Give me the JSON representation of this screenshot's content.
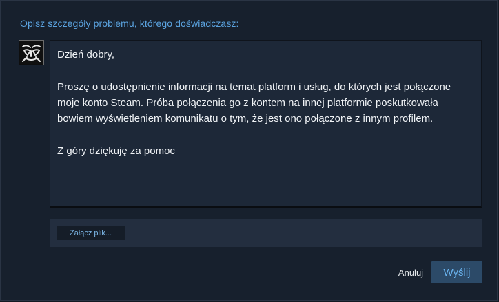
{
  "prompt": {
    "label": "Opisz szczegóły problemu, którego doświadczasz:"
  },
  "user": {
    "avatar_icon": "stylized-face-avatar-icon"
  },
  "message": {
    "text": "Dzień dobry,\n\nProszę o udostępnienie informacji na temat platform i usług, do których jest połączone moje konto Steam. Próba połączenia go z kontem na innej platformie poskutkowała bowiem wyświetleniem komunikatu o tym, że jest ono połączone z innym profilem.\n\nZ góry dziękuję za pomoc"
  },
  "attachments": {
    "attach_label": "Załącz plik..."
  },
  "actions": {
    "cancel_label": "Anuluj",
    "send_label": "Wyślij"
  },
  "colors": {
    "accent": "#5ba3e0",
    "send_button_bg": "#2c4a68",
    "panel_bg": "#17202d"
  }
}
